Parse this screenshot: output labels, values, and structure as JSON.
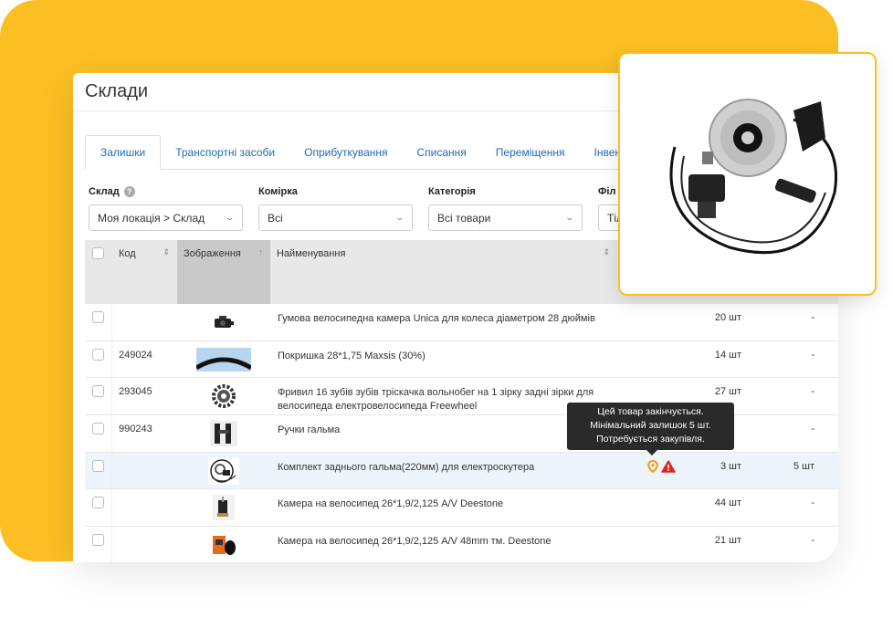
{
  "page": {
    "title": "Склади"
  },
  "tabs": [
    "Залишки",
    "Транспортні засоби",
    "Оприбуткування",
    "Списання",
    "Переміщення",
    "Інвентар"
  ],
  "filters": [
    {
      "label": "Склад",
      "value": "Моя локація > Склад",
      "help": "?"
    },
    {
      "label": "Комірка",
      "value": "Всі"
    },
    {
      "label": "Категорія",
      "value": "Всі товари"
    },
    {
      "label": "Філ",
      "value": "Тіл"
    }
  ],
  "table": {
    "headers": {
      "code": "Код",
      "image": "Зображення",
      "name": "Найменування"
    },
    "rows": [
      {
        "code": "",
        "name": "Гумова велосипедна камера Unica для колеса діаметром 28 дюймів",
        "qty": "20 шт",
        "min": "-",
        "thumb": "camera-thumb"
      },
      {
        "code": "249024",
        "name": "Покришка 28*1,75 Maxsis (30%)",
        "qty": "14 шт",
        "min": "-",
        "thumb": "tire-thumb"
      },
      {
        "code": "293045",
        "name": "Фривил 16 зубів зубів тріскачка вольнобег на 1 зірку задні зірки для велосипеда електровелосипеда Freewheel",
        "qty": "27 шт",
        "min": "-",
        "thumb": "gear-thumb"
      },
      {
        "code": "990243",
        "name": "Ручки гальма",
        "qty": "",
        "min": "-",
        "thumb": "brake-handle-thumb"
      },
      {
        "code": "",
        "name": "Комплект заднього гальма(220мм) для електроскутера",
        "qty": "3 шт",
        "min": "5 шт",
        "thumb": "brake-kit-thumb",
        "warning": true
      },
      {
        "code": "",
        "name": "Камера на велосипед 26*1,9/2,125 A/V Deestone",
        "qty": "44 шт",
        "min": "-",
        "thumb": "tube-thumb"
      },
      {
        "code": "",
        "name": "Камера на велосипед 26*1,9/2,125 A/V 48mm тм. Deestone",
        "qty": "21 шт",
        "min": "-",
        "thumb": "tube-box-thumb"
      }
    ]
  },
  "tooltip": {
    "line1": "Цей товар закінчується.",
    "line2": "Мінімальний залишок 5 шт.",
    "line3": "Потребується закупівля."
  },
  "colors": {
    "accent": "#fbbf24",
    "link": "#1e6bb8",
    "warning": "#e02424",
    "location": "#f59e0b"
  }
}
